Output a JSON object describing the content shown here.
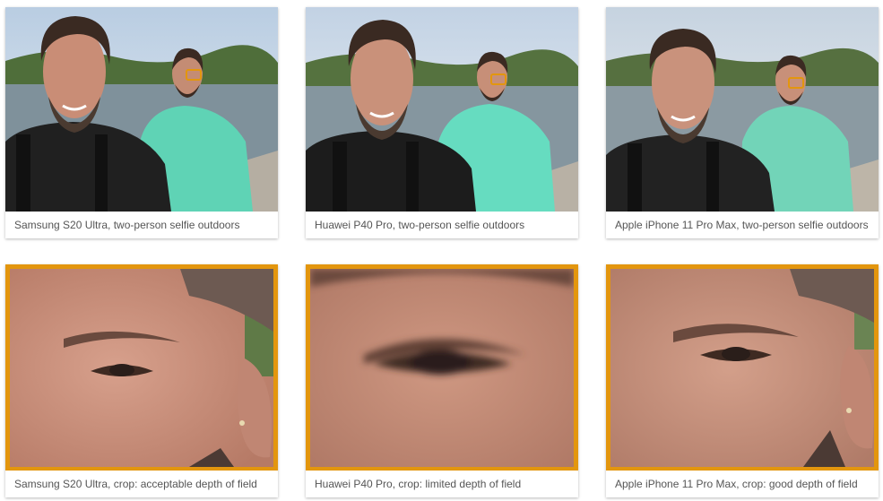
{
  "gallery": {
    "photos": [
      {
        "camera": "Samsung S20 Ultra",
        "caption": "Samsung S20 Ultra, two-person selfie outdoors"
      },
      {
        "camera": "Huawei P40 Pro",
        "caption": "Huawei P40 Pro, two-person selfie outdoors"
      },
      {
        "camera": "Apple iPhone 11 Pro Max",
        "caption": "Apple iPhone 11 Pro Max, two-person selfie outdoors"
      }
    ],
    "crops": [
      {
        "camera": "Samsung S20 Ultra",
        "caption": "Samsung S20 Ultra, crop: acceptable depth of field"
      },
      {
        "camera": "Huawei P40 Pro",
        "caption": "Huawei P40 Pro, crop: limited depth of field"
      },
      {
        "camera": "Apple iPhone 11 Pro Max",
        "caption": "Apple iPhone 11 Pro Max, crop: good depth of field"
      }
    ]
  },
  "colors": {
    "highlight": "#e3960e",
    "sky": "#c9d7e6",
    "water": "#7d8f9a",
    "hoodie": "#5fd3b5",
    "skin": "#c98d76"
  }
}
